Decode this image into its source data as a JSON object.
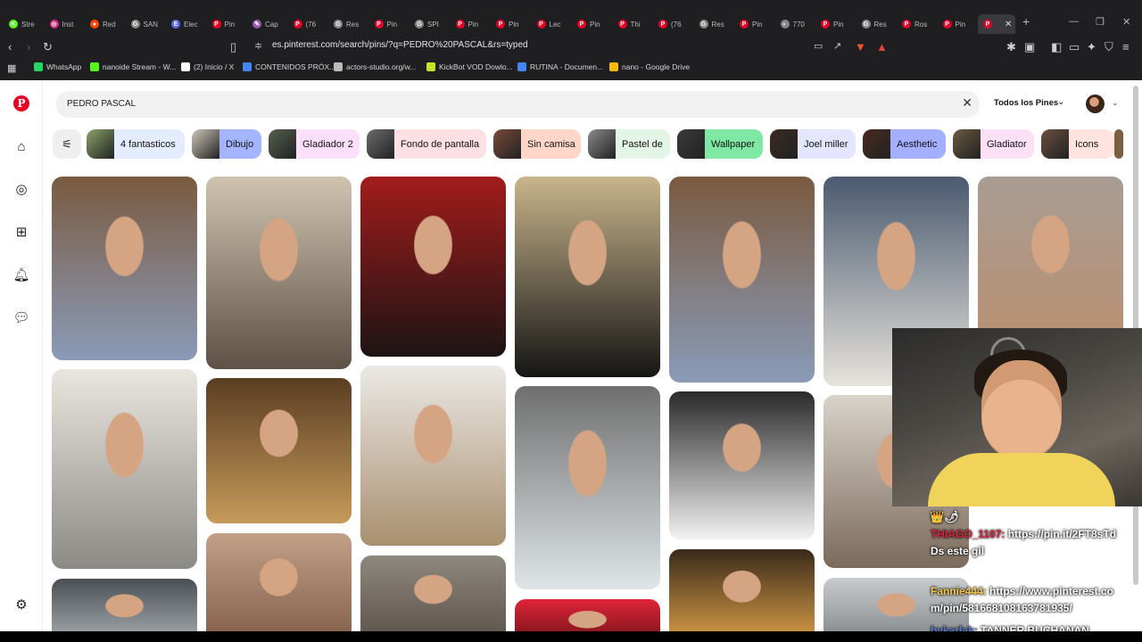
{
  "browser": {
    "tabs": [
      {
        "label": "Stre",
        "color": "#53fc18",
        "glyph": "K"
      },
      {
        "label": "Inst",
        "color": "#d62976",
        "glyph": "◎"
      },
      {
        "label": "Red",
        "color": "#ff4500",
        "glyph": "●"
      },
      {
        "label": "SAN",
        "color": "#888888",
        "glyph": "G"
      },
      {
        "label": "Elec",
        "color": "#5865f2",
        "glyph": "E"
      },
      {
        "label": "Pin",
        "color": "#e60023",
        "glyph": "P"
      },
      {
        "label": "Cap",
        "color": "#9b59b6",
        "glyph": "✎"
      },
      {
        "label": "(76",
        "color": "#e60023",
        "glyph": "P"
      },
      {
        "label": "Res",
        "color": "#888888",
        "glyph": "G"
      },
      {
        "label": "Pin",
        "color": "#e60023",
        "glyph": "P"
      },
      {
        "label": "SPI",
        "color": "#888888",
        "glyph": "G"
      },
      {
        "label": "Pin",
        "color": "#e60023",
        "glyph": "P"
      },
      {
        "label": "Pin",
        "color": "#e60023",
        "glyph": "P"
      },
      {
        "label": "Lec",
        "color": "#e60023",
        "glyph": "P"
      },
      {
        "label": "Pin",
        "color": "#e60023",
        "glyph": "P"
      },
      {
        "label": "Thi",
        "color": "#e60023",
        "glyph": "P"
      },
      {
        "label": "(76",
        "color": "#e60023",
        "glyph": "P"
      },
      {
        "label": "Res",
        "color": "#888888",
        "glyph": "G"
      },
      {
        "label": "Pin",
        "color": "#e60023",
        "glyph": "P"
      },
      {
        "label": "770",
        "color": "#888888",
        "glyph": "◐"
      },
      {
        "label": "Pin",
        "color": "#e60023",
        "glyph": "P"
      },
      {
        "label": "Res",
        "color": "#888888",
        "glyph": "G"
      },
      {
        "label": "Ros",
        "color": "#e60023",
        "glyph": "P"
      },
      {
        "label": "Pin",
        "color": "#e60023",
        "glyph": "P"
      },
      {
        "label": "",
        "color": "#e60023",
        "glyph": "P",
        "active": true
      }
    ],
    "url": "es.pinterest.com/search/pins/?q=PEDRO%20PASCAL&rs=typed",
    "bookmarks": [
      {
        "label": "WhatsApp",
        "color": "#25d366"
      },
      {
        "label": "nanoide Stream - W...",
        "color": "#53fc18"
      },
      {
        "label": "(2) Inicio / X",
        "color": "#ffffff"
      },
      {
        "label": "CONTENIDOS PRÓX...",
        "color": "#4285f4"
      },
      {
        "label": "actors-studio.org/w...",
        "color": "#bbbbbb"
      },
      {
        "label": "KickBot VOD Dowlo...",
        "color": "#c6e22e"
      },
      {
        "label": "RUTINA - Documen...",
        "color": "#4285f4"
      },
      {
        "label": "nano - Google Drive",
        "color": "#fbbc04"
      }
    ]
  },
  "search": {
    "query": "PEDRO PASCAL",
    "filter_label": "Todos los Pines"
  },
  "chips": [
    {
      "label": "4 fantasticos",
      "bg": "#e4ecff",
      "thumb": "#8aa36a"
    },
    {
      "label": "Dibujo",
      "bg": "#a4b4ff",
      "thumb": "#cfc6b8"
    },
    {
      "label": "Gladiador 2",
      "bg": "#fce0fb",
      "thumb": "#55604d"
    },
    {
      "label": "Fondo de pantalla",
      "bg": "#fde0e3",
      "thumb": "#6c6c6c"
    },
    {
      "label": "Sin camisa",
      "bg": "#ffd6c8",
      "thumb": "#7a4a3a"
    },
    {
      "label": "Pastel de",
      "bg": "#e3f5e6",
      "thumb": "#8a8a8a"
    },
    {
      "label": "Wallpaper",
      "bg": "#7fe8a4",
      "thumb": "#3a3a3a"
    },
    {
      "label": "Joel miller",
      "bg": "#e4e6ff",
      "thumb": "#3b2a22"
    },
    {
      "label": "Aesthetic",
      "bg": "#a4b0ff",
      "thumb": "#4a2a20"
    },
    {
      "label": "Gladiator",
      "bg": "#fbe0f6",
      "thumb": "#6a5a40"
    },
    {
      "label": "Icons",
      "bg": "#ffe3e0",
      "thumb": "#6a5040"
    }
  ],
  "pins": [
    {
      "label": "pin-smiling-blue-tee",
      "colors": [
        "#7a5a40",
        "#8a9bb8"
      ]
    },
    {
      "label": "pin-sepia-portrait",
      "colors": [
        "#cfc3b0",
        "#5e5145"
      ]
    },
    {
      "label": "pin-red-carpet-black-suit",
      "colors": [
        "#a31c1c",
        "#1c1414"
      ]
    },
    {
      "label": "pin-tuxedo-portrait",
      "colors": [
        "#c9b58c",
        "#151515"
      ]
    },
    {
      "label": "pin-smiling-blue-tee-2",
      "colors": [
        "#7a5a40",
        "#8a9bb8"
      ]
    },
    {
      "label": "pin-white-shirt-laugh",
      "colors": [
        "#4b5a70",
        "#e7e3dc"
      ]
    },
    {
      "label": "pin-closeup-smile",
      "colors": [
        "#a99c92",
        "#b98f70"
      ]
    },
    {
      "label": "pin-mirror-white-tee",
      "colors": [
        "#e9e6df",
        "#8c8a85"
      ]
    },
    {
      "label": "pin-vintage-suit",
      "colors": [
        "#5a3e22",
        "#c69a5a"
      ]
    },
    {
      "label": "pin-glasses-pose",
      "colors": [
        "#ebe9e5",
        "#a98f6f"
      ]
    },
    {
      "label": "pin-materialists-girl",
      "colors": [
        "#6f6f6f",
        "#dfe5e8"
      ]
    },
    {
      "label": "pin-tongue-out",
      "colors": [
        "#2a2a2a",
        "#f2f2f2"
      ]
    },
    {
      "label": "pin-cropped-laugh",
      "colors": [
        "#d9d3c9",
        "#7b6a5c"
      ]
    },
    {
      "label": "pin-dark-bottom-1",
      "colors": [
        "#4a4f55",
        "#b3b8bc"
      ]
    },
    {
      "label": "pin-warm-bottom-2",
      "colors": [
        "#c2a088",
        "#7e5a45"
      ]
    },
    {
      "label": "pin-sepia-bottom-3",
      "colors": [
        "#8e887e",
        "#5a5048"
      ]
    },
    {
      "label": "pin-red-bottom-4",
      "colors": [
        "#e0243a",
        "#5a1010"
      ]
    },
    {
      "label": "pin-bokeh-bottom-5",
      "colors": [
        "#3a2a1a",
        "#e2a44a"
      ]
    },
    {
      "label": "pin-gray-bottom-6",
      "colors": [
        "#c9ccce",
        "#7a7d80"
      ]
    }
  ],
  "chat": {
    "lines": [
      {
        "user": "THIAGO_1107:",
        "text": "https://pin.it/2FT8sTd",
        "color": "#e0233f"
      },
      {
        "user": "",
        "text": "Ds este gil",
        "color": "#ffffff"
      },
      {
        "user": "Fannie444:",
        "text": "https://www.pinterest.co",
        "color": "#f3c94e"
      },
      {
        "user": "",
        "text": "m/pin/581668108163781935/",
        "color": "#ffffff"
      },
      {
        "user": "bykarlak:",
        "text": "TANNER BUCHANAN",
        "color": "#5a7bd1"
      }
    ],
    "badges": "👑🌶"
  }
}
